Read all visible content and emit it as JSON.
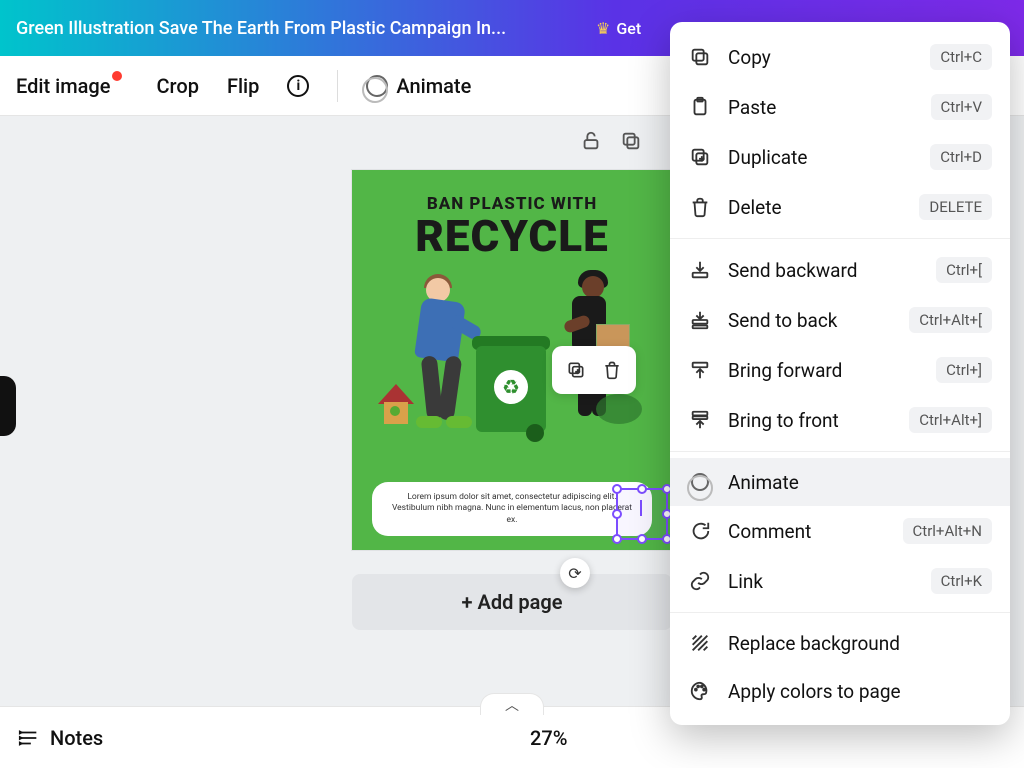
{
  "header": {
    "document_title": "Green Illustration Save The Earth From Plastic Campaign In...",
    "pro_label": "Get"
  },
  "toolbar": {
    "edit_image": "Edit image",
    "crop": "Crop",
    "flip": "Flip",
    "animate": "Animate"
  },
  "design": {
    "subtitle": "BAN PLASTIC WITH",
    "title": "RECYCLE",
    "lorem": "Lorem ipsum dolor sit amet, consectetur adipiscing elit. Vestibulum nibh magna. Nunc in elementum lacus, non placerat ex."
  },
  "add_page_label": "+ Add page",
  "context_menu": {
    "items": [
      {
        "icon": "copy",
        "label": "Copy",
        "shortcut": "Ctrl+C",
        "pill": true
      },
      {
        "icon": "paste",
        "label": "Paste",
        "shortcut": "Ctrl+V",
        "pill": true
      },
      {
        "icon": "duplicate",
        "label": "Duplicate",
        "shortcut": "Ctrl+D",
        "pill": true
      },
      {
        "icon": "trash",
        "label": "Delete",
        "shortcut": "DELETE",
        "pill": true
      }
    ],
    "arrange": [
      {
        "icon": "send-backward",
        "label": "Send backward",
        "shortcut": "Ctrl+[",
        "pill": true
      },
      {
        "icon": "send-to-back",
        "label": "Send to back",
        "shortcut": "Ctrl+Alt+[",
        "pill": true
      },
      {
        "icon": "bring-forward",
        "label": "Bring forward",
        "shortcut": "Ctrl+]",
        "pill": true
      },
      {
        "icon": "bring-to-front",
        "label": "Bring to front",
        "shortcut": "Ctrl+Alt+]",
        "pill": true
      }
    ],
    "extras": [
      {
        "icon": "animate",
        "label": "Animate",
        "shortcut": "",
        "highlight": true
      },
      {
        "icon": "comment",
        "label": "Comment",
        "shortcut": "Ctrl+Alt+N",
        "pill": true
      },
      {
        "icon": "link",
        "label": "Link",
        "shortcut": "Ctrl+K",
        "pill": true
      }
    ],
    "page": [
      {
        "icon": "hatch",
        "label": "Replace background",
        "shortcut": ""
      },
      {
        "icon": "palette",
        "label": "Apply colors to page",
        "shortcut": ""
      }
    ]
  },
  "bottom": {
    "notes": "Notes",
    "zoom": "27%"
  }
}
